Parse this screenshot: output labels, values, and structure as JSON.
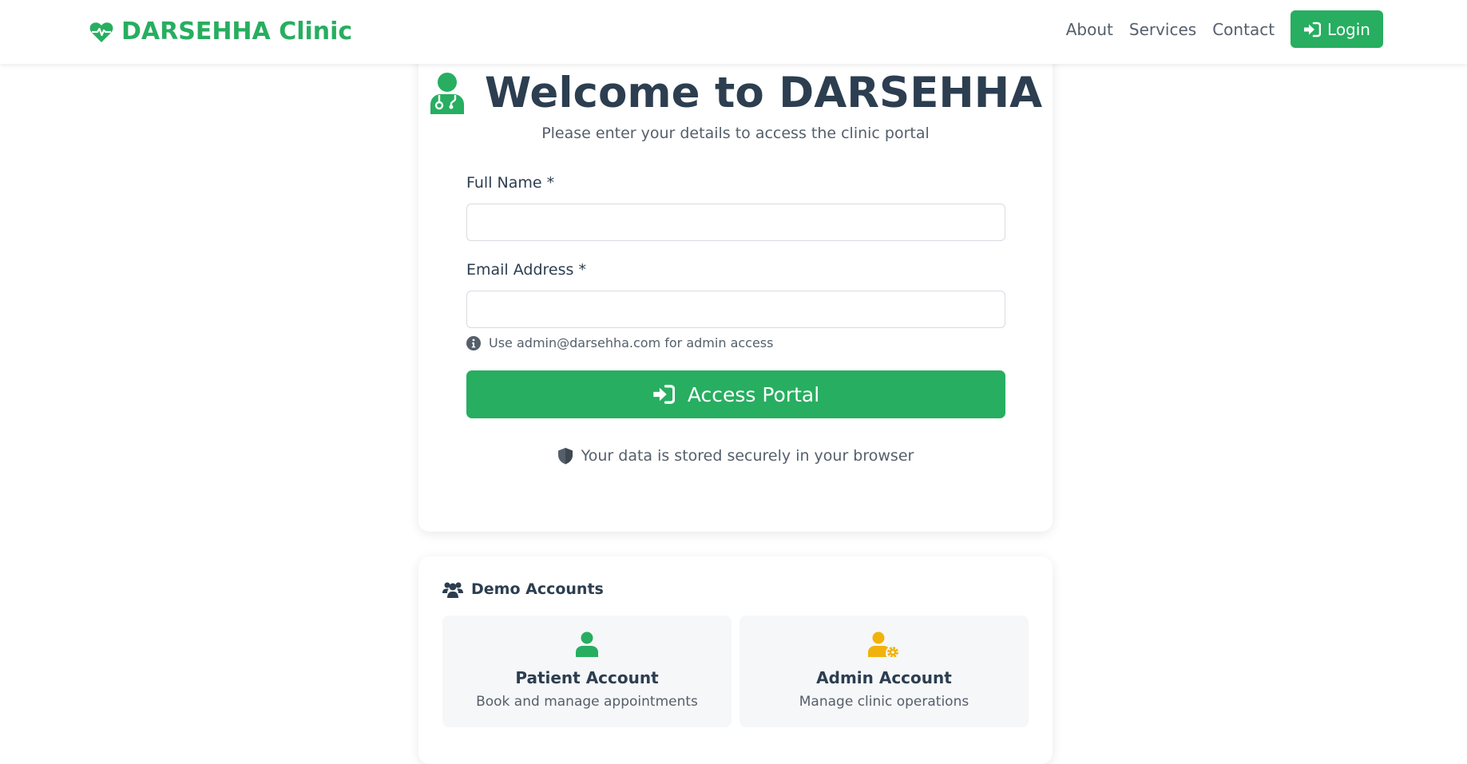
{
  "nav": {
    "brand": "DARSEHHA Clinic",
    "links": [
      "About",
      "Services",
      "Contact"
    ],
    "login_label": "Login"
  },
  "login": {
    "heading": "Welcome to DARSEHHA",
    "subtitle": "Please enter your details to access the clinic portal",
    "name_label": "Full Name *",
    "name_value": "",
    "email_label": "Email Address *",
    "email_value": "",
    "hint": "Use admin@darsehha.com for admin access",
    "submit_label": "Access Portal",
    "secure_note": "Your data is stored securely in your browser"
  },
  "demo": {
    "title": "Demo Accounts",
    "accounts": [
      {
        "name": "Patient Account",
        "description": "Book and manage appointments",
        "icon": "user-icon",
        "color": "#27ae60"
      },
      {
        "name": "Admin Account",
        "description": "Manage clinic operations",
        "icon": "user-gear-icon",
        "color": "#f1b20b"
      }
    ]
  },
  "colors": {
    "primary": "#27ae60",
    "heading": "#2c3e50",
    "muted": "#555f6b",
    "admin_accent": "#f1b20b"
  }
}
